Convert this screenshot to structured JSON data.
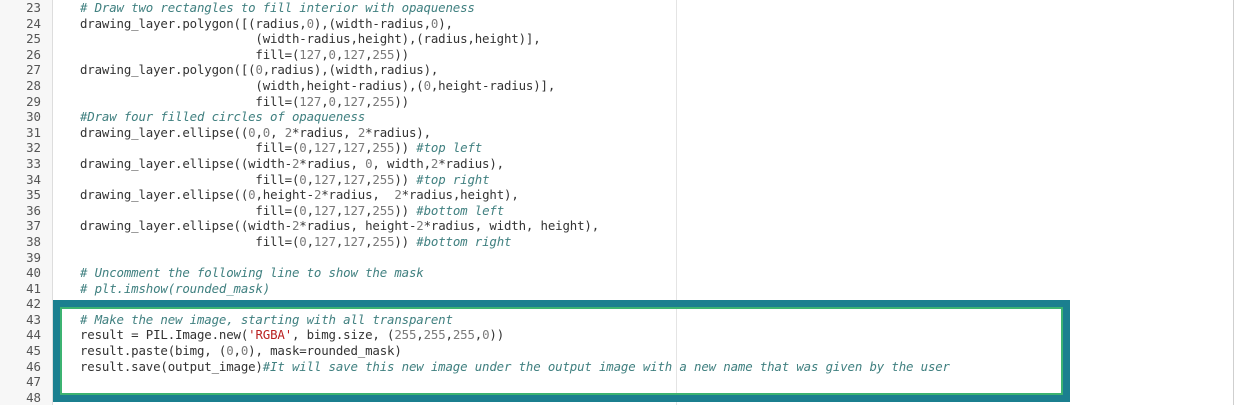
{
  "editor": {
    "lines": [
      {
        "num": "23",
        "tokens": [
          {
            "t": "# Draw two rectangles to fill interior with opaqueness",
            "c": "cm"
          }
        ]
      },
      {
        "num": "24",
        "tokens": [
          {
            "t": "drawing_layer.polygon([(radius,",
            "c": "op"
          },
          {
            "t": "0",
            "c": "nm"
          },
          {
            "t": "),(width-radius,",
            "c": "op"
          },
          {
            "t": "0",
            "c": "nm"
          },
          {
            "t": "),",
            "c": "op"
          }
        ]
      },
      {
        "num": "25",
        "tokens": [
          {
            "t": "                        (width-radius,height),(radius,height)],",
            "c": "op"
          }
        ]
      },
      {
        "num": "26",
        "tokens": [
          {
            "t": "                        fill=(",
            "c": "op"
          },
          {
            "t": "127",
            "c": "nm"
          },
          {
            "t": ",",
            "c": "op"
          },
          {
            "t": "0",
            "c": "nm"
          },
          {
            "t": ",",
            "c": "op"
          },
          {
            "t": "127",
            "c": "nm"
          },
          {
            "t": ",",
            "c": "op"
          },
          {
            "t": "255",
            "c": "nm"
          },
          {
            "t": "))",
            "c": "op"
          }
        ]
      },
      {
        "num": "27",
        "tokens": [
          {
            "t": "drawing_layer.polygon([(",
            "c": "op"
          },
          {
            "t": "0",
            "c": "nm"
          },
          {
            "t": ",radius),(width,radius),",
            "c": "op"
          }
        ]
      },
      {
        "num": "28",
        "tokens": [
          {
            "t": "                        (width,height-radius),(",
            "c": "op"
          },
          {
            "t": "0",
            "c": "nm"
          },
          {
            "t": ",height-radius)],",
            "c": "op"
          }
        ]
      },
      {
        "num": "29",
        "tokens": [
          {
            "t": "                        fill=(",
            "c": "op"
          },
          {
            "t": "127",
            "c": "nm"
          },
          {
            "t": ",",
            "c": "op"
          },
          {
            "t": "0",
            "c": "nm"
          },
          {
            "t": ",",
            "c": "op"
          },
          {
            "t": "127",
            "c": "nm"
          },
          {
            "t": ",",
            "c": "op"
          },
          {
            "t": "255",
            "c": "nm"
          },
          {
            "t": "))",
            "c": "op"
          }
        ]
      },
      {
        "num": "30",
        "tokens": [
          {
            "t": "#Draw four filled circles of opaqueness",
            "c": "cm"
          }
        ]
      },
      {
        "num": "31",
        "tokens": [
          {
            "t": "drawing_layer.ellipse((",
            "c": "op"
          },
          {
            "t": "0",
            "c": "nm"
          },
          {
            "t": ",",
            "c": "op"
          },
          {
            "t": "0",
            "c": "nm"
          },
          {
            "t": ", ",
            "c": "op"
          },
          {
            "t": "2",
            "c": "nm"
          },
          {
            "t": "*radius, ",
            "c": "op"
          },
          {
            "t": "2",
            "c": "nm"
          },
          {
            "t": "*radius),",
            "c": "op"
          }
        ]
      },
      {
        "num": "32",
        "tokens": [
          {
            "t": "                        fill=(",
            "c": "op"
          },
          {
            "t": "0",
            "c": "nm"
          },
          {
            "t": ",",
            "c": "op"
          },
          {
            "t": "127",
            "c": "nm"
          },
          {
            "t": ",",
            "c": "op"
          },
          {
            "t": "127",
            "c": "nm"
          },
          {
            "t": ",",
            "c": "op"
          },
          {
            "t": "255",
            "c": "nm"
          },
          {
            "t": ")) ",
            "c": "op"
          },
          {
            "t": "#top left",
            "c": "cm"
          }
        ]
      },
      {
        "num": "33",
        "tokens": [
          {
            "t": "drawing_layer.ellipse((width-",
            "c": "op"
          },
          {
            "t": "2",
            "c": "nm"
          },
          {
            "t": "*radius, ",
            "c": "op"
          },
          {
            "t": "0",
            "c": "nm"
          },
          {
            "t": ", width,",
            "c": "op"
          },
          {
            "t": "2",
            "c": "nm"
          },
          {
            "t": "*radius),",
            "c": "op"
          }
        ]
      },
      {
        "num": "34",
        "tokens": [
          {
            "t": "                        fill=(",
            "c": "op"
          },
          {
            "t": "0",
            "c": "nm"
          },
          {
            "t": ",",
            "c": "op"
          },
          {
            "t": "127",
            "c": "nm"
          },
          {
            "t": ",",
            "c": "op"
          },
          {
            "t": "127",
            "c": "nm"
          },
          {
            "t": ",",
            "c": "op"
          },
          {
            "t": "255",
            "c": "nm"
          },
          {
            "t": ")) ",
            "c": "op"
          },
          {
            "t": "#top right",
            "c": "cm"
          }
        ]
      },
      {
        "num": "35",
        "tokens": [
          {
            "t": "drawing_layer.ellipse((",
            "c": "op"
          },
          {
            "t": "0",
            "c": "nm"
          },
          {
            "t": ",height-",
            "c": "op"
          },
          {
            "t": "2",
            "c": "nm"
          },
          {
            "t": "*radius,  ",
            "c": "op"
          },
          {
            "t": "2",
            "c": "nm"
          },
          {
            "t": "*radius,height),",
            "c": "op"
          }
        ]
      },
      {
        "num": "36",
        "tokens": [
          {
            "t": "                        fill=(",
            "c": "op"
          },
          {
            "t": "0",
            "c": "nm"
          },
          {
            "t": ",",
            "c": "op"
          },
          {
            "t": "127",
            "c": "nm"
          },
          {
            "t": ",",
            "c": "op"
          },
          {
            "t": "127",
            "c": "nm"
          },
          {
            "t": ",",
            "c": "op"
          },
          {
            "t": "255",
            "c": "nm"
          },
          {
            "t": ")) ",
            "c": "op"
          },
          {
            "t": "#bottom left",
            "c": "cm"
          }
        ]
      },
      {
        "num": "37",
        "tokens": [
          {
            "t": "drawing_layer.ellipse((width-",
            "c": "op"
          },
          {
            "t": "2",
            "c": "nm"
          },
          {
            "t": "*radius, height-",
            "c": "op"
          },
          {
            "t": "2",
            "c": "nm"
          },
          {
            "t": "*radius, width, height),",
            "c": "op"
          }
        ]
      },
      {
        "num": "38",
        "tokens": [
          {
            "t": "                        fill=(",
            "c": "op"
          },
          {
            "t": "0",
            "c": "nm"
          },
          {
            "t": ",",
            "c": "op"
          },
          {
            "t": "127",
            "c": "nm"
          },
          {
            "t": ",",
            "c": "op"
          },
          {
            "t": "127",
            "c": "nm"
          },
          {
            "t": ",",
            "c": "op"
          },
          {
            "t": "255",
            "c": "nm"
          },
          {
            "t": ")) ",
            "c": "op"
          },
          {
            "t": "#bottom right",
            "c": "cm"
          }
        ]
      },
      {
        "num": "39",
        "tokens": []
      },
      {
        "num": "40",
        "tokens": [
          {
            "t": "# Uncomment the following line to show the mask",
            "c": "cm"
          }
        ]
      },
      {
        "num": "41",
        "tokens": [
          {
            "t": "# plt.imshow(rounded_mask)",
            "c": "cm"
          }
        ]
      },
      {
        "num": "42",
        "tokens": []
      },
      {
        "num": "43",
        "tokens": [
          {
            "t": "# Make the new image, starting with all transparent",
            "c": "cm"
          }
        ]
      },
      {
        "num": "44",
        "tokens": [
          {
            "t": "result = PIL.Image.new(",
            "c": "op"
          },
          {
            "t": "'RGBA'",
            "c": "st"
          },
          {
            "t": ", bimg.size, (",
            "c": "op"
          },
          {
            "t": "255",
            "c": "nm"
          },
          {
            "t": ",",
            "c": "op"
          },
          {
            "t": "255",
            "c": "nm"
          },
          {
            "t": ",",
            "c": "op"
          },
          {
            "t": "255",
            "c": "nm"
          },
          {
            "t": ",",
            "c": "op"
          },
          {
            "t": "0",
            "c": "nm"
          },
          {
            "t": "))",
            "c": "op"
          }
        ]
      },
      {
        "num": "45",
        "tokens": [
          {
            "t": "result.paste(bimg, (",
            "c": "op"
          },
          {
            "t": "0",
            "c": "nm"
          },
          {
            "t": ",",
            "c": "op"
          },
          {
            "t": "0",
            "c": "nm"
          },
          {
            "t": "), mask=rounded_mask)",
            "c": "op"
          }
        ]
      },
      {
        "num": "46",
        "tokens": [
          {
            "t": "result.save(output_image)",
            "c": "op"
          },
          {
            "t": "#It will save this new image under the output image with a new name that was given by the user",
            "c": "cm"
          }
        ]
      },
      {
        "num": "47",
        "tokens": []
      },
      {
        "num": "48",
        "tokens": []
      }
    ]
  },
  "colors": {
    "comment": "#408080",
    "number": "#7a7a7a",
    "string": "#ba2121",
    "default": "#333333",
    "highlight_border": "#1b7f8f",
    "highlight_inner": "#3cb371"
  }
}
